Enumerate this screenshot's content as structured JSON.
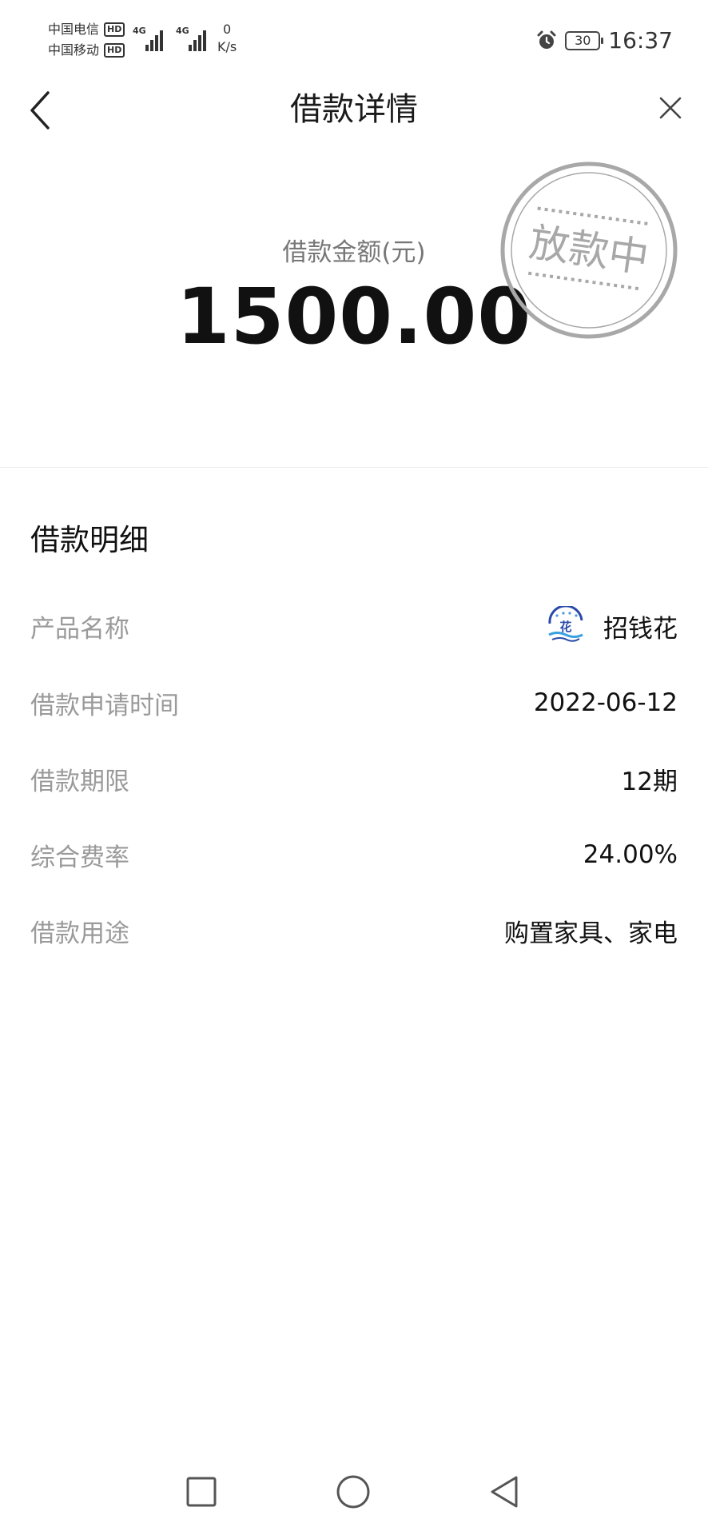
{
  "status_bar": {
    "carrier1": "中国电信",
    "carrier2": "中国移动",
    "hd_badge": "HD",
    "network1": "4G",
    "network2": "4G",
    "speed_value": "0",
    "speed_unit": "K/s",
    "battery": "30",
    "time": "16:37"
  },
  "header": {
    "title": "借款详情"
  },
  "loan": {
    "amount_label": "借款金额(元)",
    "amount": "1500.00",
    "status_stamp": "放款中"
  },
  "details": {
    "section_title": "借款明细",
    "rows": [
      {
        "label": "产品名称",
        "value": "招钱花",
        "logo_text": "花"
      },
      {
        "label": "借款申请时间",
        "value": "2022-06-12"
      },
      {
        "label": "借款期限",
        "value": "12期"
      },
      {
        "label": "综合费率",
        "value": "24.00%"
      },
      {
        "label": "借款用途",
        "value": "购置家具、家电"
      }
    ]
  },
  "icons": {
    "back": "chevron-left-icon",
    "close": "close-icon",
    "alarm": "alarm-icon",
    "nav_recent": "square-icon",
    "nav_home": "circle-icon",
    "nav_back": "triangle-back-icon"
  },
  "colors": {
    "label_gray": "#9a9a9a",
    "stamp_gray": "#a8a8a8",
    "logo_blue": "#2a4aa8"
  }
}
